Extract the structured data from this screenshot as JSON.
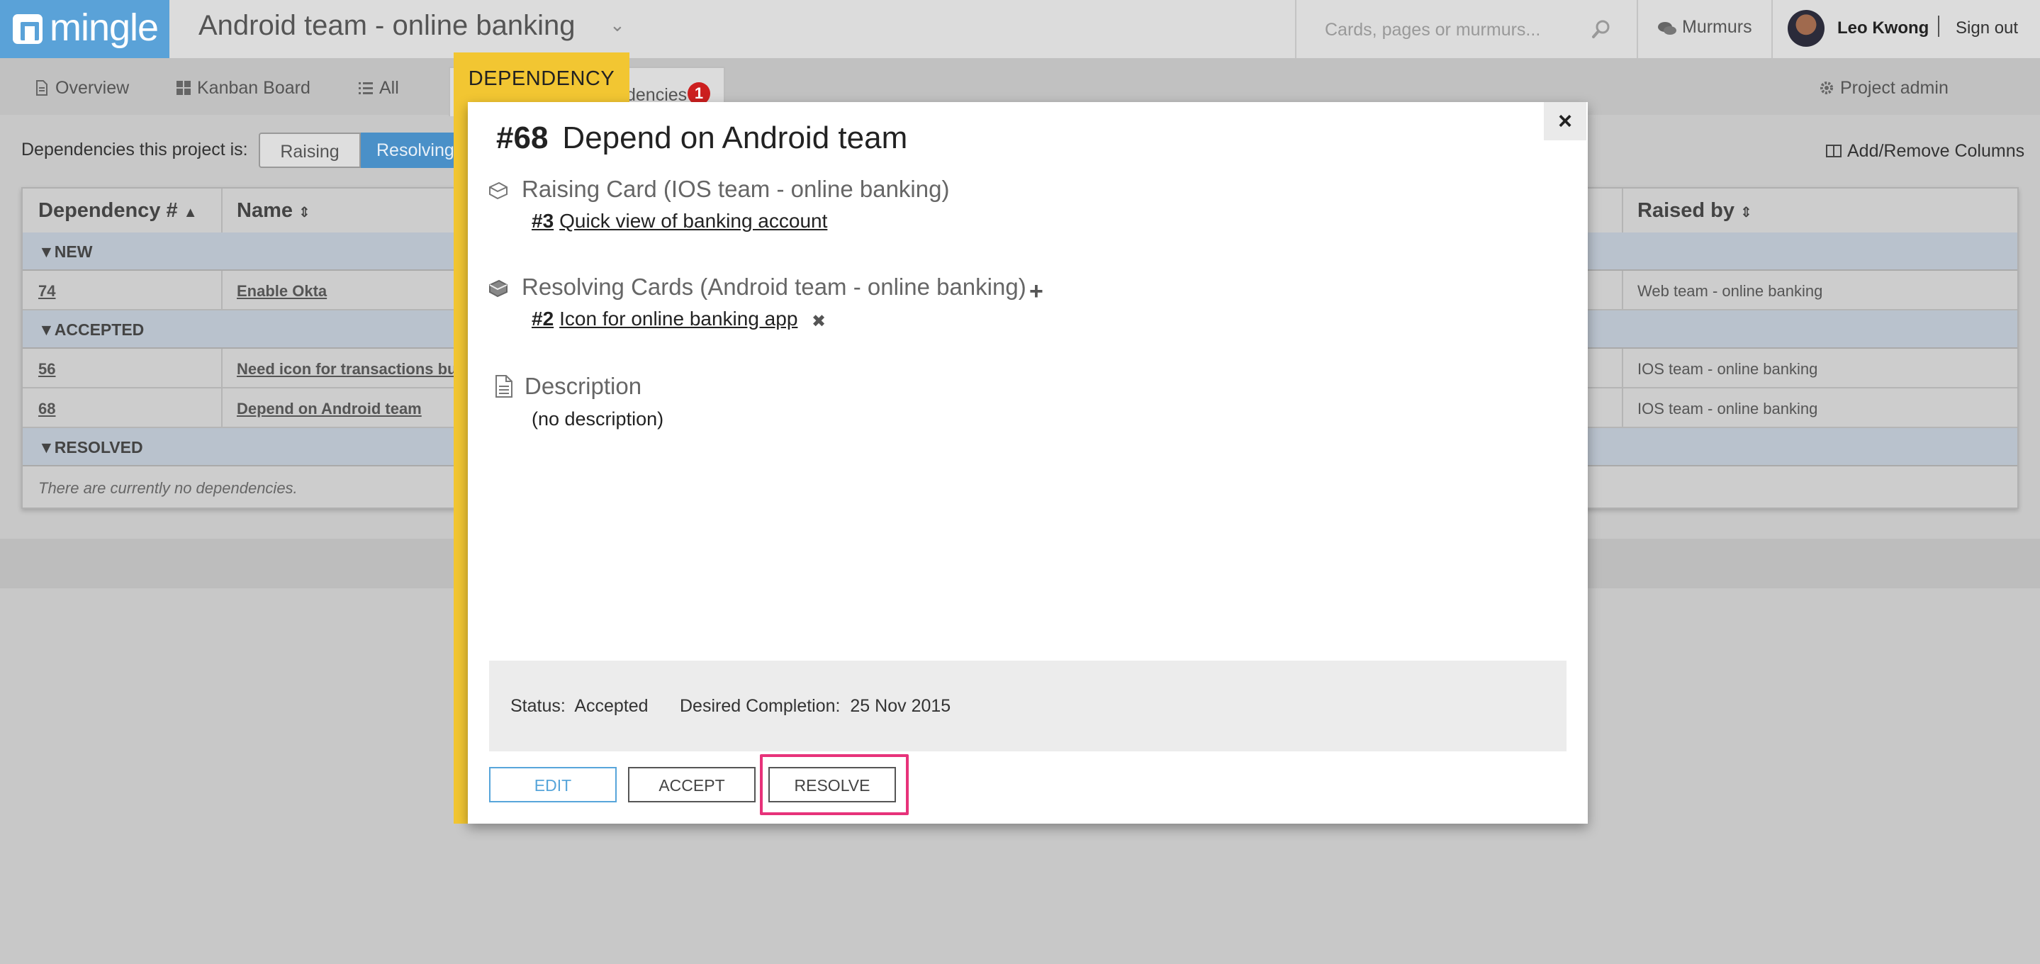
{
  "app": {
    "logo_text": "mingle",
    "project_title": "Android team - online banking",
    "search": {
      "placeholder": "Cards, pages or murmurs..."
    },
    "murmurs_label": "Murmurs",
    "user_name": "Leo Kwong",
    "signout_label": "Sign out"
  },
  "nav": {
    "overview": "Overview",
    "kanban": "Kanban Board",
    "all": "All",
    "dependencies_partial": "dencies",
    "dependencies_count": "1",
    "project_admin": "Project admin"
  },
  "filter": {
    "label": "Dependencies this project is:",
    "raising": "Raising",
    "resolving": "Resolving"
  },
  "add_remove_columns": "Add/Remove Columns",
  "table": {
    "headers": {
      "dependency_num": "Dependency #",
      "name": "Name",
      "raised_by": "Raised by"
    },
    "groups": {
      "new": "NEW",
      "accepted": "ACCEPTED",
      "resolved": "RESOLVED"
    },
    "rows": [
      {
        "num": "74",
        "name": "Enable Okta",
        "raised_by": "Web team - online banking"
      },
      {
        "num": "56",
        "name": "Need icon for transactions bu",
        "raised_by": "IOS team - online banking"
      },
      {
        "num": "68",
        "name": "Depend on Android team",
        "raised_by": "IOS team - online banking"
      }
    ],
    "empty_message": "There are currently no dependencies."
  },
  "modal": {
    "tag": "DEPENDENCY",
    "close": "×",
    "number": "#68",
    "title": "Depend on Android team",
    "raising_section": "Raising Card (IOS team - online banking)",
    "raising_card": {
      "num": "#3",
      "text": "Quick view of banking account"
    },
    "resolving_section": "Resolving Cards (Android team - online banking)",
    "resolving_card": {
      "num": "#2",
      "text": "Icon for online banking app"
    },
    "add_symbol": "+",
    "remove_symbol": "✖",
    "description_section": "Description",
    "description_text": "(no description)",
    "status_label": "Status:",
    "status_value": "Accepted",
    "completion_label": "Desired Completion:",
    "completion_value": "25 Nov 2015",
    "buttons": {
      "edit": "EDIT",
      "accept": "ACCEPT",
      "resolve": "RESOLVE"
    }
  },
  "colors": {
    "brand_blue": "#5aa2d8",
    "dependency_yellow": "#f2c632",
    "highlight_pink": "#e7327a",
    "badge_red": "#cc1f1f"
  }
}
